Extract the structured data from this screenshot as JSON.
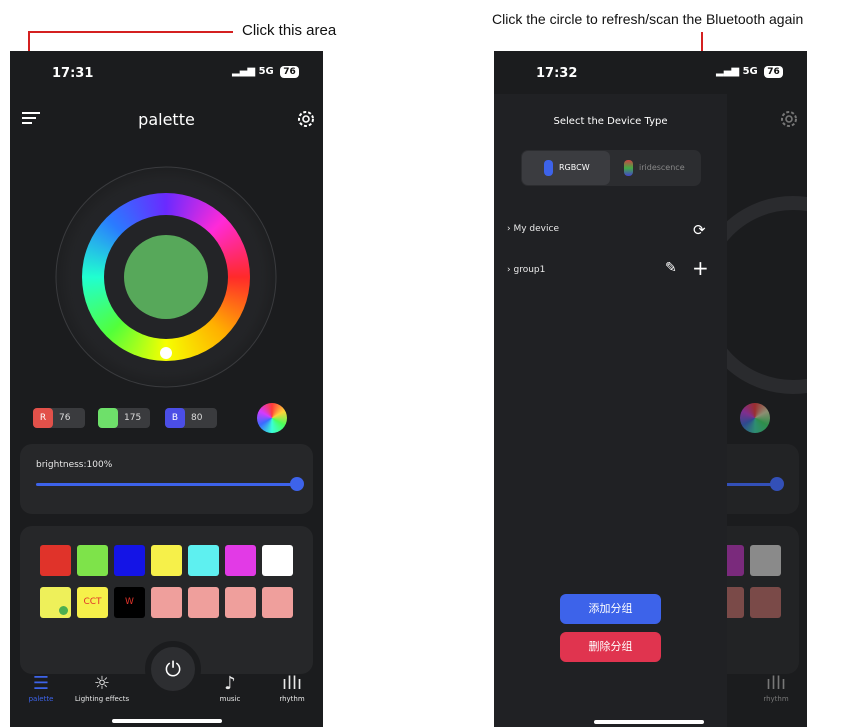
{
  "annotations": {
    "left": "Click this area",
    "right": "Click the circle to refresh/scan the Bluetooth again"
  },
  "left_phone": {
    "status": {
      "time": "17:31",
      "network": "5G",
      "battery": "76"
    },
    "header": {
      "title": "palette"
    },
    "rgb": {
      "r_label": "R",
      "r_value": "76",
      "g_label": "G",
      "g_value": "175",
      "b_label": "B",
      "b_value": "80"
    },
    "brightness": {
      "label": "brightness:100%",
      "value": 1.0
    },
    "swatch_labels": {
      "cct": "CCT",
      "w": "W"
    },
    "swatch_colors": {
      "row1": [
        "#e0332a",
        "#7ee34a",
        "#1414e6",
        "#f6f04a",
        "#5ef0f0",
        "#e23ae6",
        "#ffffff"
      ],
      "row2_tail": [
        "#ef9f9c",
        "#ef9f9c",
        "#ef9f9c",
        "#ef9f9c"
      ]
    },
    "center_color": "#57a85a",
    "nav": {
      "palette": "palette",
      "effects": "Lighting effects",
      "music": "music",
      "rhythm": "rhythm"
    }
  },
  "right_phone": {
    "status": {
      "time": "17:32",
      "network": "5G",
      "battery": "76"
    },
    "drawer": {
      "title": "Select the Device Type",
      "seg_rgbcw": "RGBCW",
      "seg_iridescence": "iridescence",
      "my_device": "My device",
      "group1": "group1",
      "add_group": "添加分组",
      "delete_group": "删除分组"
    },
    "background_nav": {
      "rhythm": "rhythm"
    }
  },
  "colors": {
    "accent_blue": "#3d63ea",
    "delete_red": "#e0344f",
    "annot_red": "#d42020"
  }
}
